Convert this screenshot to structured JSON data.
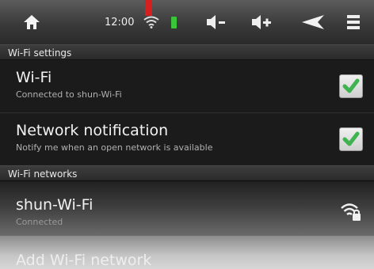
{
  "status_bar": {
    "time": "12:00",
    "icons": [
      "home-icon",
      "wifi-signal-icon",
      "battery-icon",
      "volume-down-icon",
      "volume-up-icon",
      "back-icon",
      "menu-icon"
    ]
  },
  "sections": {
    "wifi_settings": "Wi-Fi settings",
    "wifi_networks": "Wi-Fi networks"
  },
  "wifi": {
    "title": "Wi-Fi",
    "summary": "Connected to shun-Wi-Fi",
    "checked": true
  },
  "notification": {
    "title": "Network notification",
    "summary": "Notify me when an open network is available",
    "checked": true
  },
  "network": {
    "name": "shun-Wi-Fi",
    "status": "Connected"
  },
  "add_network": {
    "label": "Add Wi-Fi network"
  },
  "colors": {
    "check_green": "#3fb34f",
    "battery_green": "#3ac43a",
    "pointer_red": "#d62020"
  }
}
